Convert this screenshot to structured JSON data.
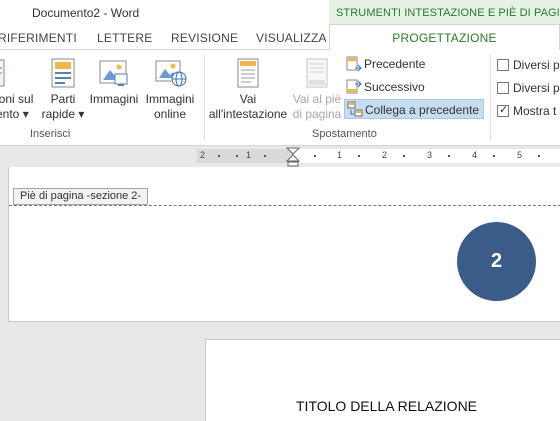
{
  "window": {
    "title": "Documento2 - Word"
  },
  "context_tab": {
    "label": "STRUMENTI INTESTAZIONE E PIÈ DI PAGINA"
  },
  "tabs": [
    {
      "label": "RIFERIMENTI"
    },
    {
      "label": "LETTERE"
    },
    {
      "label": "REVISIONE"
    },
    {
      "label": "VISUALIZZA"
    },
    {
      "label": "PROGETTAZIONE",
      "active": true
    }
  ],
  "ribbon": {
    "insert_group": {
      "label": "Inserisci",
      "info_doc": {
        "line1": "ioni sul",
        "line2": "ento ▾"
      },
      "quick_parts": {
        "line1": "Parti",
        "line2": "rapide ▾"
      },
      "pictures": {
        "line1": "Immagini"
      },
      "online_pictures": {
        "line1": "Immagini",
        "line2": "online"
      }
    },
    "nav_group": {
      "label": "Spostamento",
      "goto_header": {
        "line1": "Vai",
        "line2": "all'intestazione"
      },
      "goto_footer": {
        "line1": "Vai al piè",
        "line2": "di pagina"
      },
      "previous": "Precedente",
      "next": "Successivo",
      "link_previous": "Collega a precedente"
    },
    "options_group": {
      "different_first": "Diversi p",
      "different_odd_even": "Diversi p",
      "show_text": "Mostra t"
    }
  },
  "ruler": {
    "numbers": [
      "2",
      "1",
      "1",
      "2",
      "3",
      "4",
      "5"
    ]
  },
  "document": {
    "footer_tag": "Piè di pagina -sezione 2-",
    "page_number": "2",
    "next_page_title": "TITOLO DELLA RELAZIONE"
  },
  "colors": {
    "accent_green": "#2a7a2a",
    "context_tab_bg": "#e6f2e6",
    "page_number_circle": "#3b5b89",
    "selected_button": "#c5dcf1"
  }
}
